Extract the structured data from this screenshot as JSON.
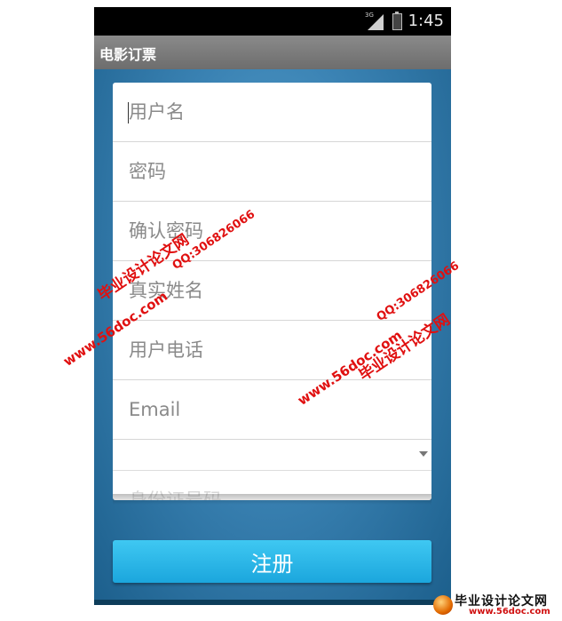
{
  "status_bar": {
    "network": "3G",
    "time": "1:45"
  },
  "action_bar": {
    "title": "电影订票"
  },
  "form": {
    "fields": [
      {
        "placeholder": "用户名"
      },
      {
        "placeholder": "密码"
      },
      {
        "placeholder": "确认密码"
      },
      {
        "placeholder": "真实姓名"
      },
      {
        "placeholder": "用户电话"
      },
      {
        "placeholder": "Email"
      }
    ],
    "spinner_value": "",
    "partial_field_placeholder": "身份证号码"
  },
  "register_button": {
    "label": "注册"
  },
  "watermarks": {
    "site_name": "毕业设计论文网",
    "url": "www.56doc.com",
    "qq": "QQ:306826066"
  },
  "corner_logo": {
    "text": "毕业设计论文网",
    "url": "www.56doc.com"
  },
  "colors": {
    "primary_button": "#1ba6dd",
    "action_bar": "#7b7b7b",
    "background": "#3a82b3"
  }
}
